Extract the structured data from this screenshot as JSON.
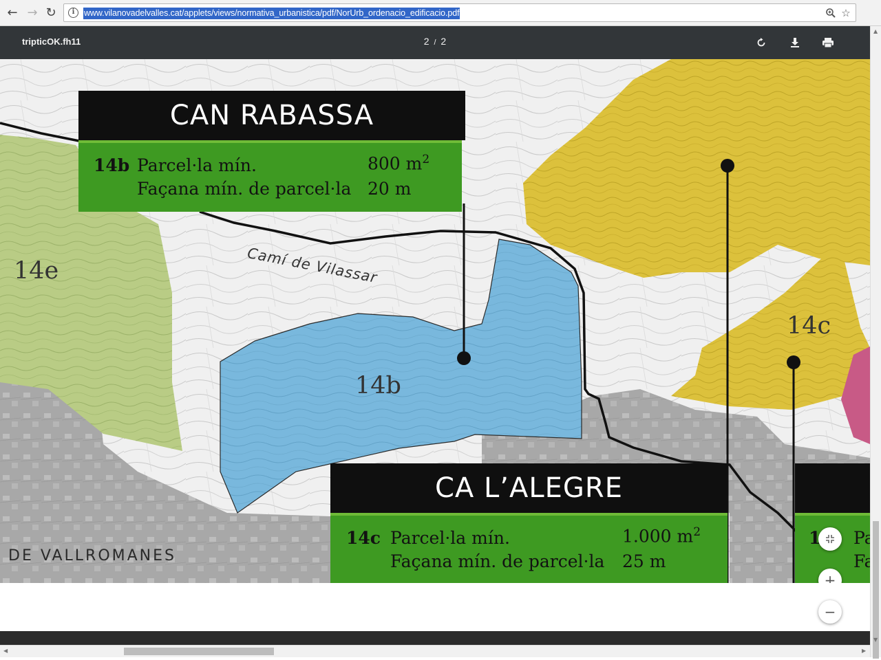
{
  "browser": {
    "url": "www.vilanovadelvalles.cat/applets/views/normativa_urbanistica/pdf/NorUrb_ordenacio_edificacio.pdf",
    "icons": [
      "back-arrow-icon",
      "forward-arrow-icon",
      "reload-icon",
      "info-icon",
      "zoom-icon",
      "star-icon"
    ]
  },
  "viewer": {
    "title": "tripticOK.fh11",
    "page_current": "2",
    "page_separator": "/",
    "page_total": "2",
    "icons": [
      "rotate-icon",
      "download-icon",
      "print-icon"
    ]
  },
  "map": {
    "street_label": "Camí de Vilassar",
    "area_label": "DE VALLROMANES",
    "zone_labels": {
      "zone_14e": "14e",
      "zone_14b": "14b",
      "zone_14c": "14c"
    },
    "colors": {
      "zone_14b": "#79b8dd",
      "zone_14e": "#b9cc85",
      "zone_14c": "#dcc13c",
      "zone_pink": "#c85a86",
      "urban_gray": "#a9a9a9",
      "info_green": "#3e9a22",
      "info_black": "#0f0f0f"
    }
  },
  "can_rabassa": {
    "title": "CAN RABASSA",
    "zone": "14b",
    "min_parcel_label": "Parcel·la mín.",
    "min_parcel_value": "800 m",
    "min_parcel_exp": "2",
    "min_facade_label": "Façana mín. de parcel·la",
    "min_facade_value": "20 m"
  },
  "ca_lalegre": {
    "title": "CA L’ALEGRE",
    "zone": "14c",
    "min_parcel_label": "Parcel·la mín.",
    "min_parcel_value": "1.000 m",
    "min_parcel_exp": "2",
    "min_facade_label": "Façana mín. de parcel·la",
    "min_facade_value": "25 m"
  },
  "third_box": {
    "zone_partial": "1",
    "line1_partial": "Pa",
    "line2_partial": "Fa"
  },
  "zoom": {
    "fit_icon": "fit-page-icon",
    "zoom_in": "+",
    "zoom_out": "−"
  }
}
